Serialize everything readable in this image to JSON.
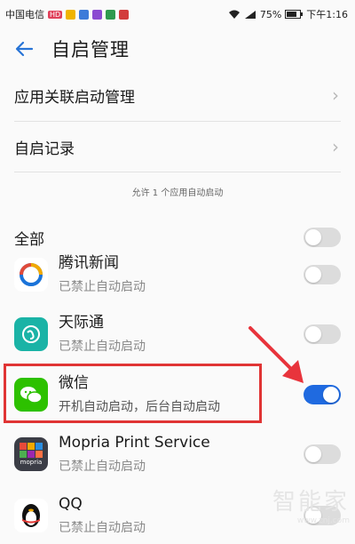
{
  "status_bar": {
    "carrier": "中国电信",
    "hd_badge": "HD",
    "battery": "75%",
    "time": "下午1:16"
  },
  "header": {
    "title": "自启管理"
  },
  "menu": {
    "assoc_label": "应用关联启动管理",
    "record_label": "自启记录"
  },
  "hint_text": "允许 1 个应用自动启动",
  "all_row": {
    "label": "全部",
    "enabled": false
  },
  "apps": [
    {
      "name": "腾讯新闻",
      "status": "已禁止自动启动",
      "enabled": false
    },
    {
      "name": "天际通",
      "status": "已禁止自动启动",
      "enabled": false
    },
    {
      "name": "微信",
      "status": "开机自动启动，后台自动启动",
      "enabled": true
    },
    {
      "name": "Mopria Print Service",
      "status": "已禁止自动启动",
      "enabled": false,
      "icon_label": "mopria"
    },
    {
      "name": "QQ",
      "status": "已禁止自动启动",
      "enabled": false
    }
  ],
  "watermark": {
    "title": "智能家",
    "url": "www.znj.com"
  },
  "colors": {
    "accent": "#1f6ae0",
    "highlight": "#e03434",
    "arrow": "#e8343c",
    "wechat": "#2dc100"
  }
}
